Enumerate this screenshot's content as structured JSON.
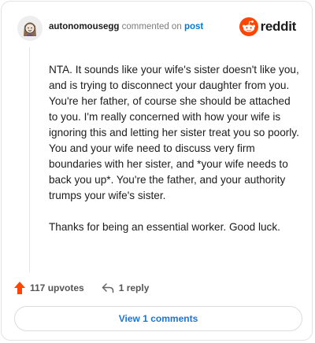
{
  "comment": {
    "username": "autonomousegg",
    "action_text": "commented on",
    "target_link": "post",
    "paragraphs": [
      "NTA. It sounds like your wife's sister doesn't like you, and is trying to disconnect your daughter from you. You're her father, of course she should be attached to you. I'm really concerned with how your wife is ignoring this and letting her sister treat you so poorly. You and your wife need to discuss very firm boundaries with her sister, and *your wife needs to back you up*. You're the father, and your authority trumps your wife's sister.",
      "Thanks for being an essential worker. Good luck."
    ]
  },
  "brand": {
    "wordmark": "reddit",
    "accent_color": "#ff4500"
  },
  "actions": {
    "upvotes_label": "117 upvotes",
    "reply_label": "1 reply"
  },
  "footer": {
    "view_comments_label": "View 1 comments"
  },
  "icons": {
    "avatar": "avatar-icon",
    "logo": "reddit-snoo-icon",
    "upvote": "upvote-arrow-icon",
    "reply": "reply-arrow-icon"
  }
}
